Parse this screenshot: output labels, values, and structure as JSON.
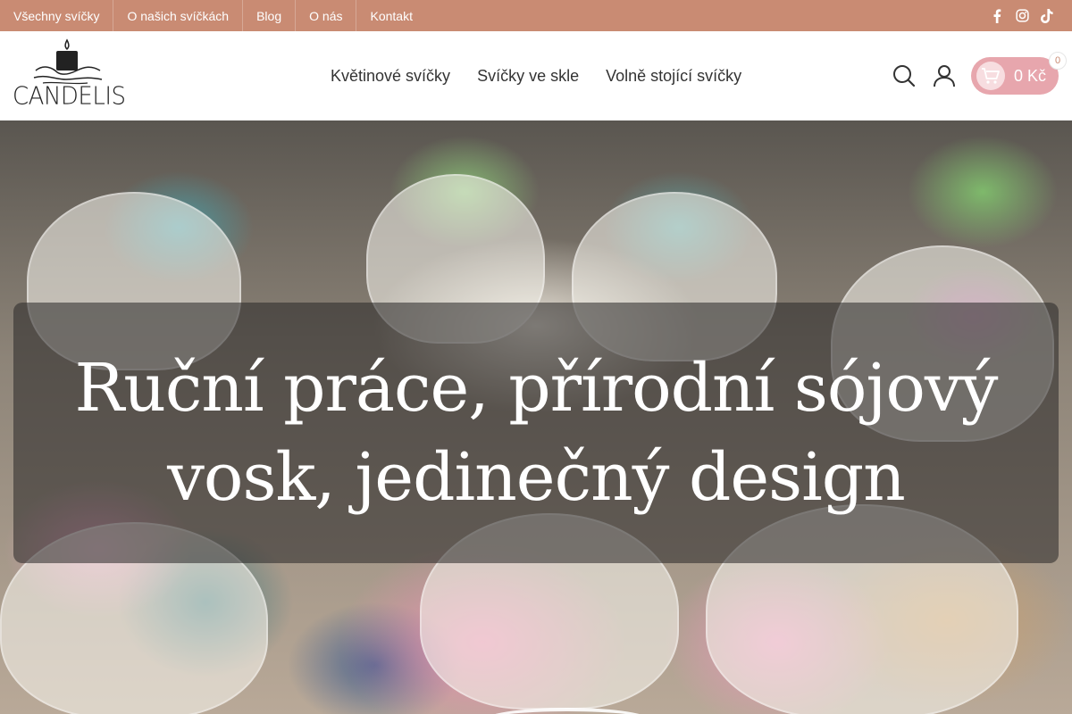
{
  "topbar": {
    "links": [
      "Všechny svíčky",
      "O našich svíčkách",
      "Blog",
      "O nás",
      "Kontakt"
    ],
    "social_icons": [
      "facebook-icon",
      "instagram-icon",
      "tiktok-icon"
    ],
    "background": "#c98b73"
  },
  "header": {
    "logo_text": "CANDELIS",
    "nav": [
      "Květinové svíčky",
      "Svíčky ve skle",
      "Volně stojící svíčky"
    ],
    "cart_total": "0 Kč",
    "cart_count": "0",
    "cart_color": "#e7a6ad"
  },
  "hero": {
    "caption_line1": "Ruční práce, přírodní sójový",
    "caption_line2": "vosk, jedinečný design"
  }
}
